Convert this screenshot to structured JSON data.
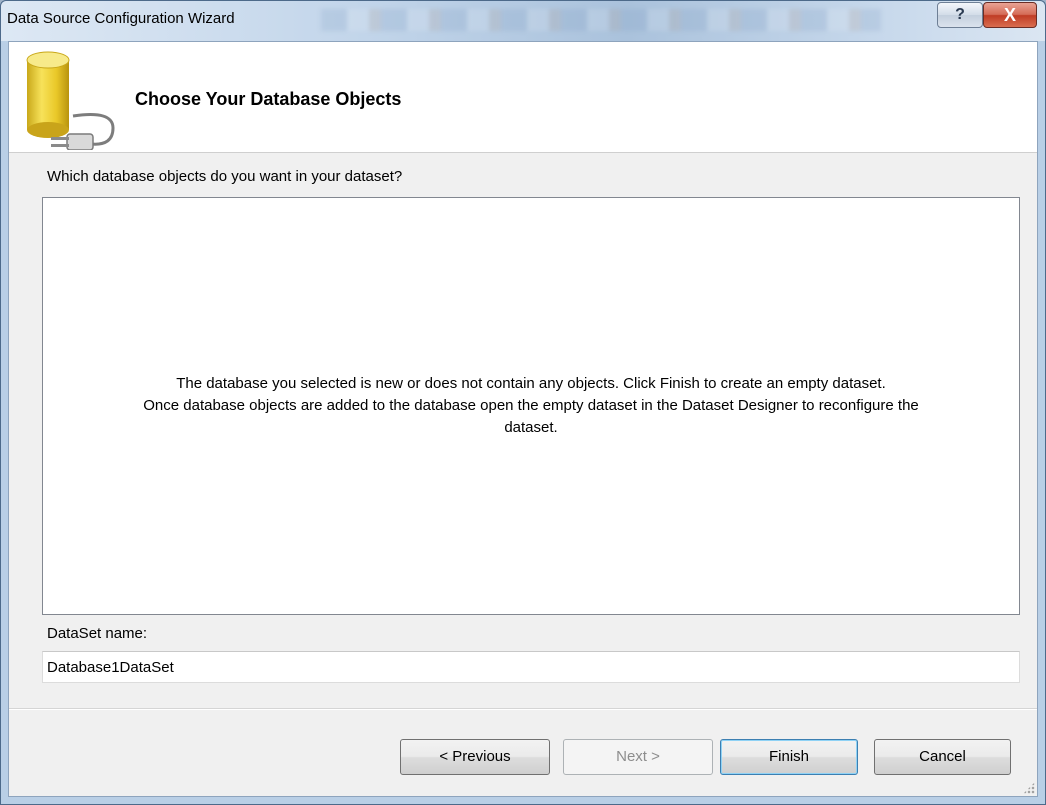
{
  "window": {
    "title": "Data Source Configuration Wizard",
    "help_glyph": "?",
    "close_glyph": "X"
  },
  "header": {
    "title": "Choose Your Database Objects",
    "icon": "database-plug-icon"
  },
  "main": {
    "question": "Which database objects do you want in your dataset?",
    "empty_message": {
      "line1": "The database you selected is new or does not contain any objects. Click Finish to create an empty dataset.",
      "line2": "Once database objects are added to the database open the empty dataset in the Dataset Designer to reconfigure the",
      "line3": "dataset."
    },
    "dataset_name_label": "DataSet name:",
    "dataset_name_value": "Database1DataSet"
  },
  "buttons": {
    "previous": "< Previous",
    "next": "Next >",
    "finish": "Finish",
    "cancel": "Cancel"
  },
  "colors": {
    "accent": "#3c7fb1",
    "close": "#c03c25",
    "database": "#e8c832"
  }
}
